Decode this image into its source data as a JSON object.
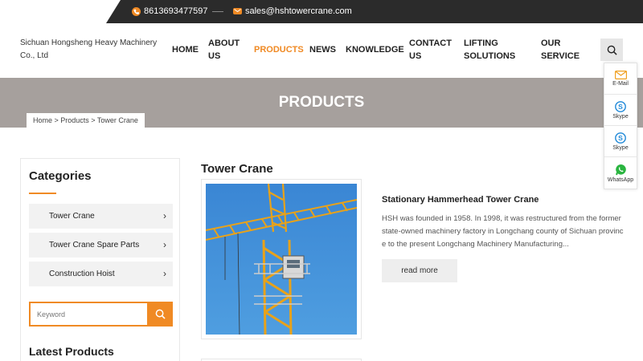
{
  "topbar": {
    "phone": "8613693477597",
    "email": "sales@hshtowercrane.com"
  },
  "header": {
    "company": "Sichuan Hongsheng Heavy Machinery Co., Ltd",
    "nav": [
      {
        "label": "HOME"
      },
      {
        "label": "ABOUT US"
      },
      {
        "label": "PRODUCTS"
      },
      {
        "label": "NEWS"
      },
      {
        "label": "KNOWLEDGE"
      },
      {
        "label": "CONTACT US"
      },
      {
        "label": "LIFTING SOLUTIONS"
      },
      {
        "label": "OUR SERVICE"
      }
    ],
    "active_nav": "PRODUCTS"
  },
  "float_contacts": [
    {
      "label": "E-Mail",
      "icon": "mail-icon"
    },
    {
      "label": "Skype",
      "icon": "skype-icon"
    },
    {
      "label": "Skype",
      "icon": "skype-icon"
    },
    {
      "label": "WhatsApp",
      "icon": "whatsapp-icon"
    }
  ],
  "banner": {
    "title": "PRODUCTS",
    "breadcrumb": "Home > Products > Tower Crane"
  },
  "sidebar": {
    "categories_title": "Categories",
    "categories": [
      {
        "label": "Tower Crane"
      },
      {
        "label": "Tower Crane Spare Parts"
      },
      {
        "label": "Construction Hoist"
      }
    ],
    "search_placeholder": "Keyword",
    "latest_title": "Latest Products"
  },
  "main": {
    "title": "Tower Crane",
    "product": {
      "name": "Stationary Hammerhead Tower Crane",
      "description": "HSH was founded in 1958. In 1998, it was restructured from the former state-owned machinery factory in Longchang county of Sichuan province to the present Longchang Machinery Manufacturing...",
      "read_more": "read more"
    }
  },
  "colors": {
    "accent": "#f08a24",
    "topbar": "#2b2b2b",
    "banner": "#a6a09d",
    "sky": "#3f8fd6",
    "crane": "#e8a21a"
  }
}
